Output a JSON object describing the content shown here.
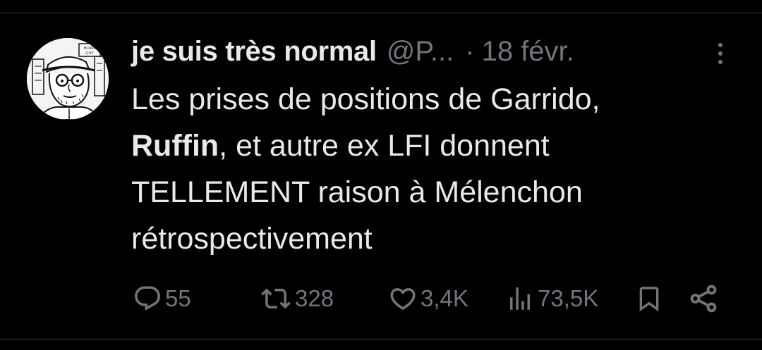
{
  "tweet": {
    "display_name": "je suis très normal",
    "handle": "@P...",
    "dot": "·",
    "date": "18 févr.",
    "text": {
      "line1": "Les prises de positions de Garrido,",
      "line2_bold": "Ruffin",
      "line2_rest": ", et autre ex LFI donnent",
      "line3": "TELLEMENT raison à Mélenchon",
      "line4": "rétrospectivement"
    },
    "avatar_sign": "BORN GUY"
  },
  "actions": {
    "replies": "55",
    "reposts": "328",
    "likes": "3,4K",
    "views": "73,5K"
  },
  "colors": {
    "background": "#000000",
    "text": "#e7e9ea",
    "muted": "#71767b",
    "border": "#2f3336"
  }
}
